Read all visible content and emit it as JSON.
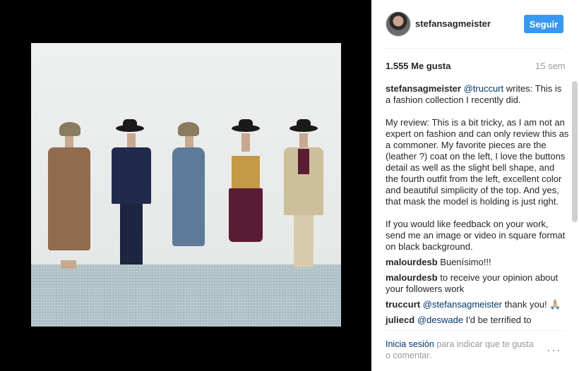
{
  "header": {
    "username": "stefansagmeister",
    "follow_label": "Seguir"
  },
  "stats": {
    "likes": "1.555 Me gusta",
    "time": "15 sem"
  },
  "caption": {
    "author": "stefansagmeister",
    "mention": "@truccurt",
    "text": " writes: This is a fashion collection I recently did.\n\nMy review: This is a bit tricky, as I am not an expert on fashion and can only review this as a commoner. My favorite pieces are the (leather ?) coat on the left, I love the buttons detail as well as the slight bell shape, and the fourth outfit from the left, excellent color and beautiful simplicity of the top. And yes, that mask the model is holding is just right.\n\nIf you would like feedback on your work, send me an image or video in square format on black background."
  },
  "comments": [
    {
      "author": "malourdesb",
      "text": " Buenísimo!!!"
    },
    {
      "author": "malourdesb",
      "text": " to receive your opinion about your followers work"
    },
    {
      "author": "truccurt",
      "mention": "@stefansagmeister",
      "text": " thank you! 🙏🏼"
    },
    {
      "author": "juliecd",
      "mention": "@deswade",
      "text": " I'd be terrified to"
    }
  ],
  "footer": {
    "login": "Inicia sesión",
    "rest": " para indicar que te gusta o comentar.",
    "more_icon": "···"
  },
  "colors": {
    "accent": "#3897f0",
    "link": "#003569"
  }
}
